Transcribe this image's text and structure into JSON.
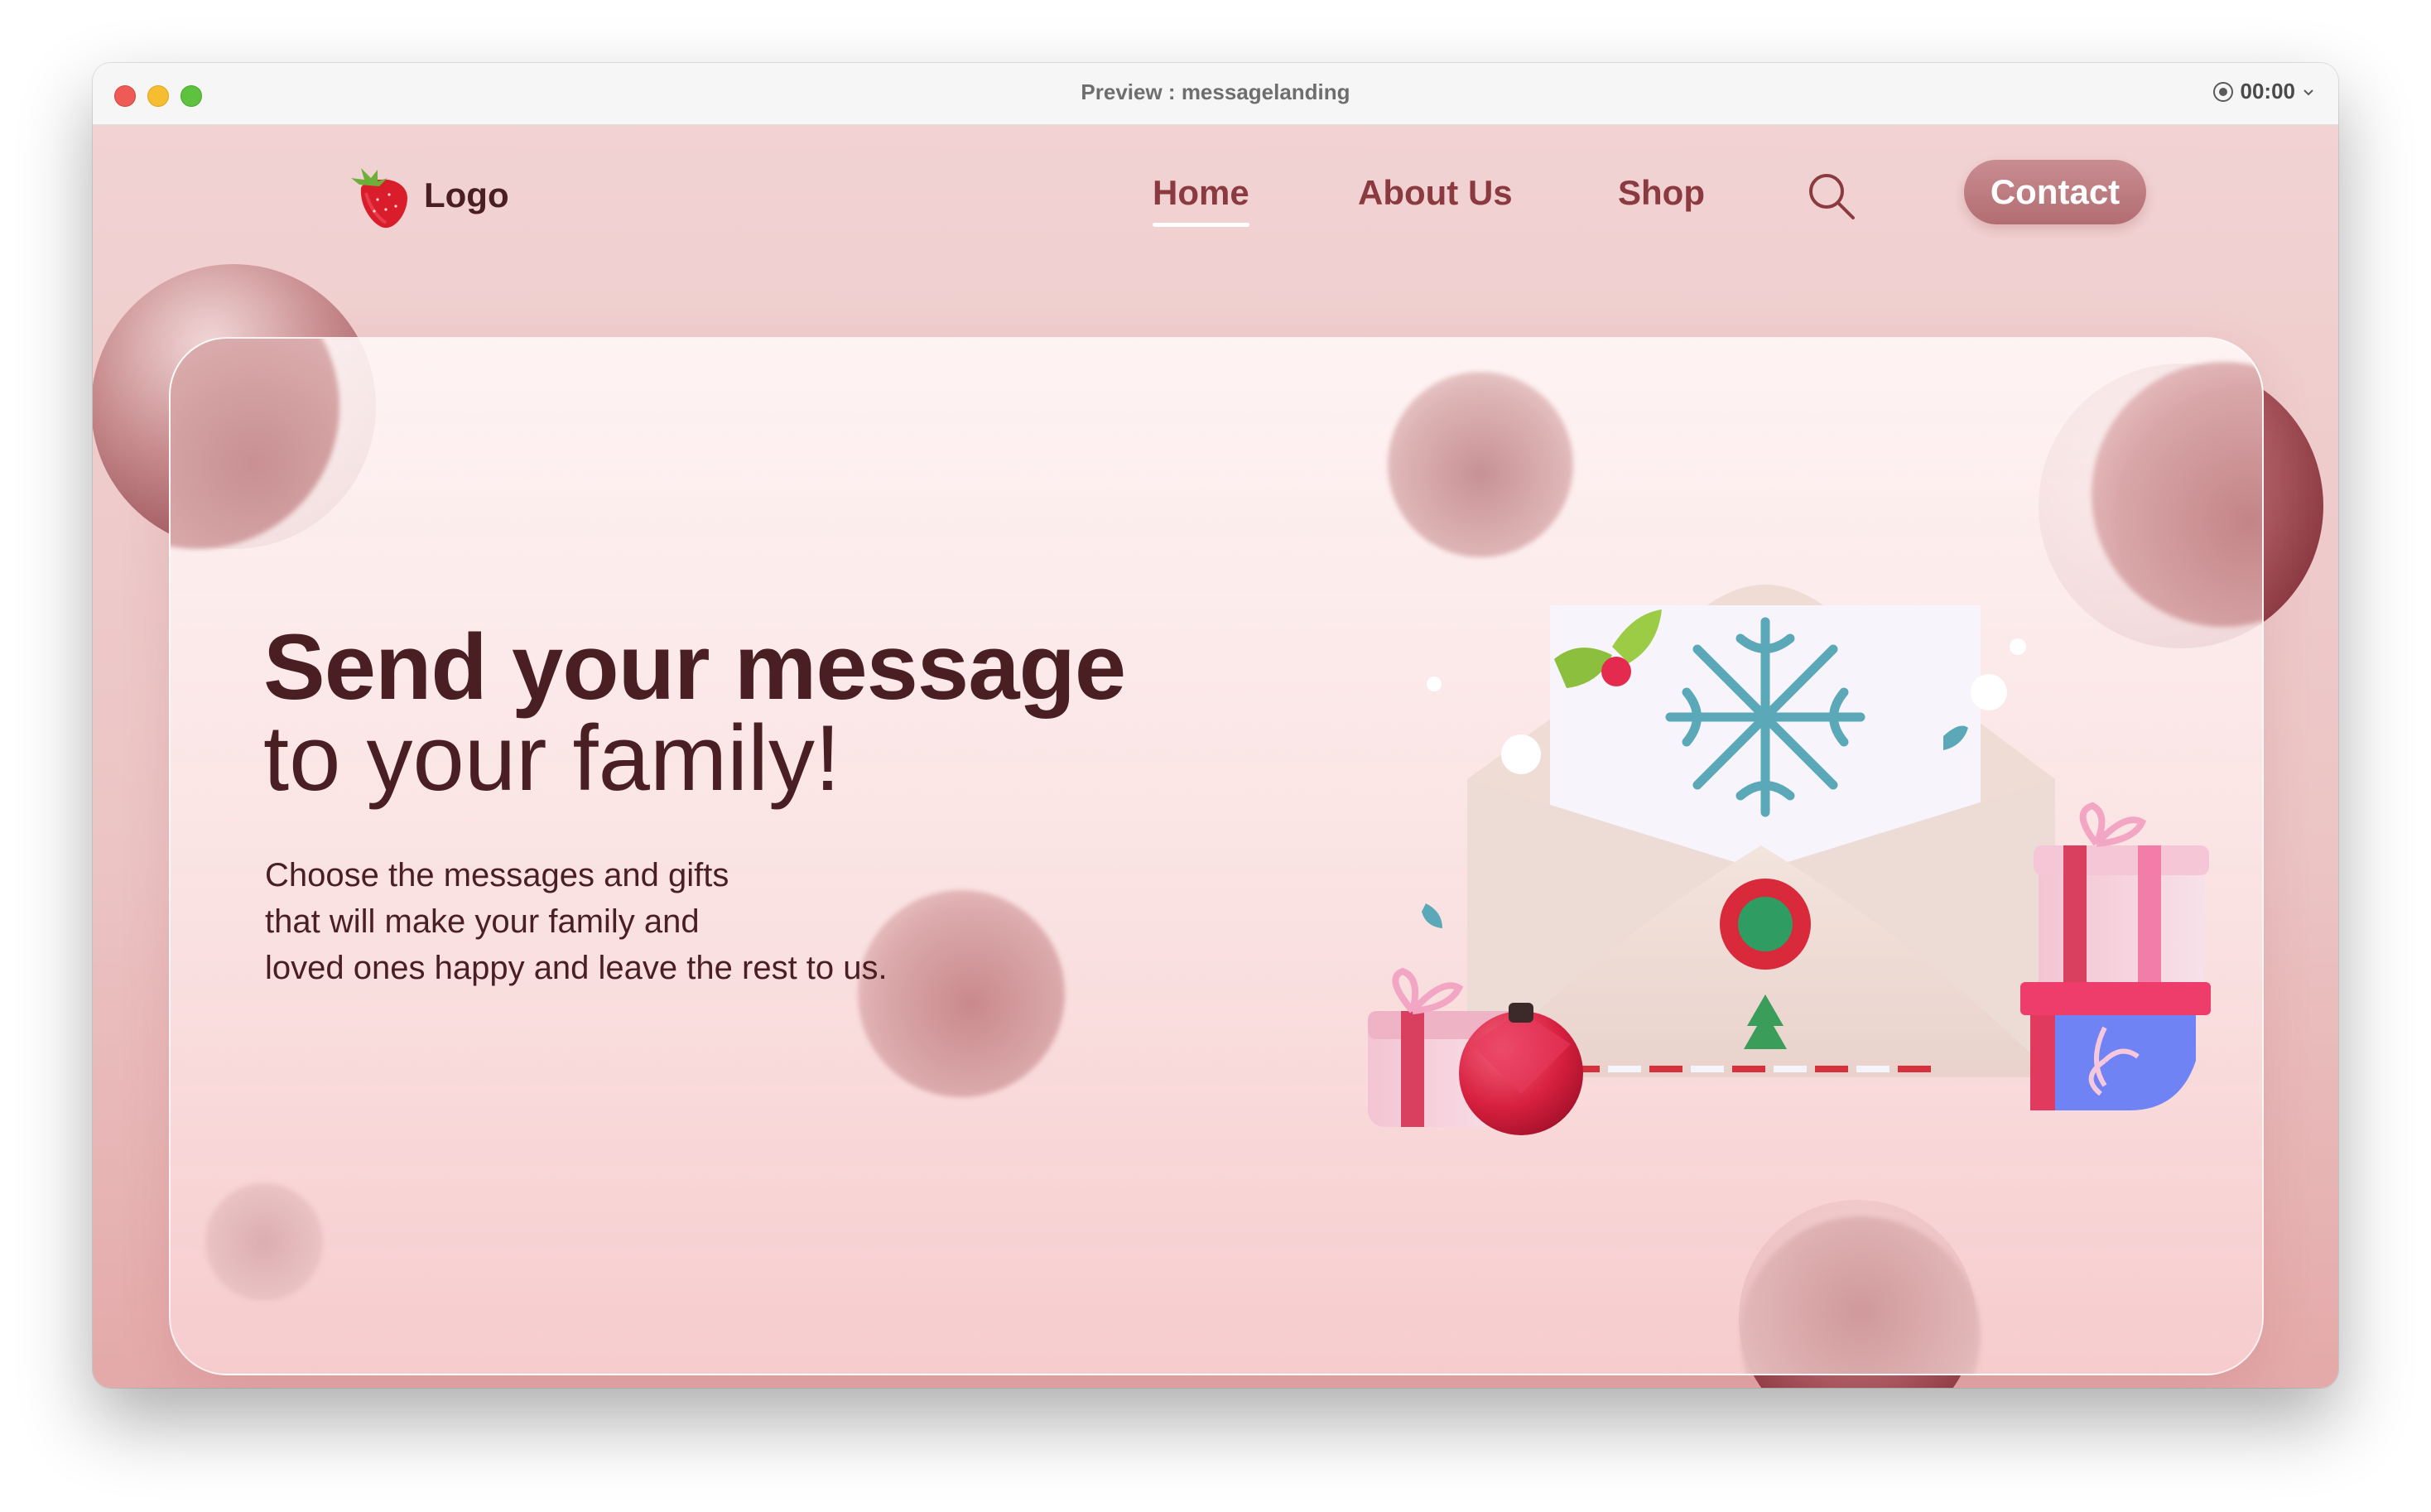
{
  "window": {
    "title": "Preview : messagelanding",
    "recording_time": "00:00"
  },
  "icons": {
    "record": "record-icon",
    "dropdown": "chevron-down-icon",
    "logo": "strawberry-icon",
    "search": "search-icon"
  },
  "nav": {
    "logo_text": "Logo",
    "home": "Home",
    "about": "About Us",
    "shop": "Shop",
    "contact": "Contact"
  },
  "hero": {
    "headline_bold": "Send your message",
    "headline_regular": "to your family!",
    "description": [
      "Choose the messages and gifts",
      "that will make your family and",
      "loved ones happy and leave the rest to us."
    ]
  },
  "colors": {
    "background": "#ecc4c4",
    "text_dark": "#4a1f24",
    "nav_text": "#8b3b40",
    "contact_button": "#bf7f84"
  }
}
